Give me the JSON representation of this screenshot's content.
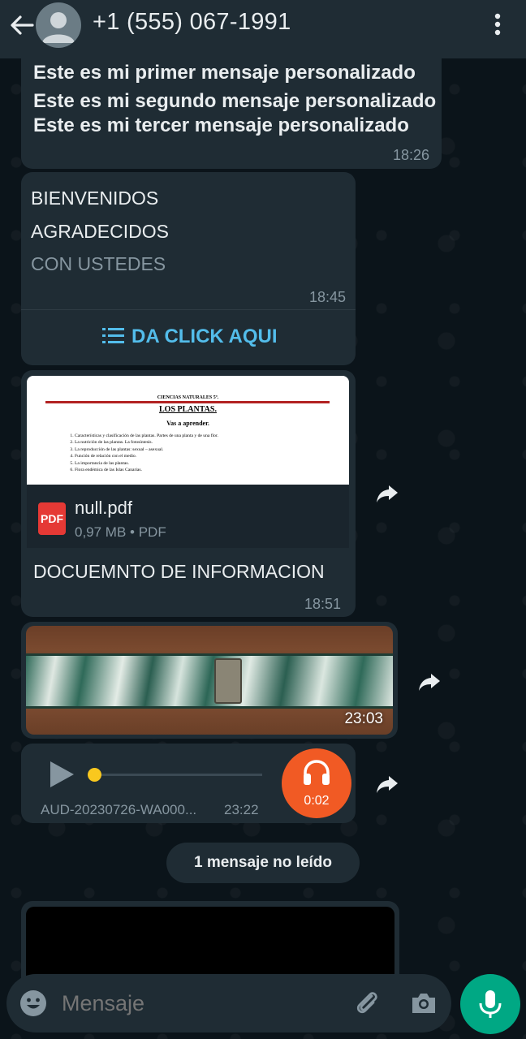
{
  "header": {
    "title": "+1 (555) 067-1991"
  },
  "messages": {
    "msg1": {
      "lines": [
        "Este es mi primer mensaje personalizado",
        "Este es mi segundo mensaje personalizado",
        "Este es mi tercer mensaje personalizado"
      ],
      "time": "18:26"
    },
    "msg2": {
      "title": "BIENVENIDOS",
      "line2": "AGRADECIDOS",
      "line3": "CON USTEDES",
      "time": "18:45",
      "action_label": "DA CLICK AQUI"
    },
    "msg3": {
      "preview": {
        "heading": "CIENCIAS NATURALES 5º.",
        "title": "LOS PLANTAS.",
        "subtitle": "Vas a aprender.",
        "items": [
          "Características y clasificación de las plantas. Partes de una planta y de una flor.",
          "La nutrición de las plantas. La fotosíntesis.",
          "La reproducción de las plantas: sexual – asexual.",
          "Función de relación con el medio.",
          "La importancia de las plantas.",
          "Flora endémica de las Islas Canarias."
        ]
      },
      "icon_label": "PDF",
      "file_name": "null.pdf",
      "file_meta": "0,97 MB • PDF",
      "caption": "DOCUEMNTO DE INFORMACION",
      "time": "18:51"
    },
    "msg4": {
      "time": "23:03"
    },
    "msg5": {
      "file_name": "AUD-20230726-WA000...",
      "time": "23:22",
      "duration": "0:02"
    }
  },
  "unread_label": "1 mensaje no leído",
  "input": {
    "placeholder": "Mensaje"
  },
  "colors": {
    "accent": "#00a884",
    "link": "#53bdeb",
    "audio_badge": "#f15a24",
    "bubble": "#1f2c34"
  }
}
